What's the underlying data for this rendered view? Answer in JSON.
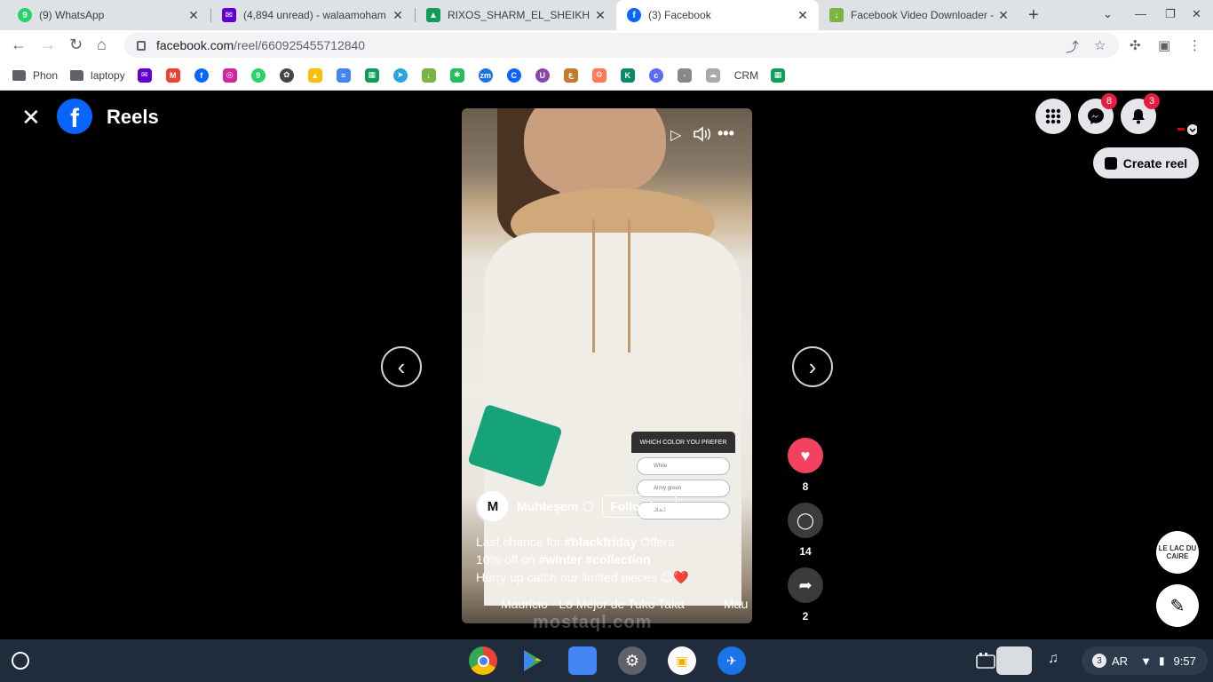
{
  "tabs": [
    {
      "title": "(9) WhatsApp",
      "color": "#25d366",
      "glyph": "9"
    },
    {
      "title": "(4,894 unread) - walaamoham",
      "color": "#6001d2",
      "glyph": "✉"
    },
    {
      "title": "RIXOS_SHARM_EL_SHEIKH - G",
      "color": "#0f9d58",
      "glyph": "▲"
    },
    {
      "title": "(3) Facebook",
      "color": "#0866ff",
      "glyph": "f"
    },
    {
      "title": "Facebook Video Downloader -",
      "color": "#7cb342",
      "glyph": "↓"
    }
  ],
  "omnibox": {
    "host": "facebook.com",
    "path": "/reel/660925455712840"
  },
  "bookmarks": {
    "folder1": "Phon",
    "folder2": "laptopy",
    "crm": "CRM"
  },
  "header": {
    "title": "Reels",
    "messenger_badge": "8",
    "notifications_badge": "3",
    "create_reel": "Create reel"
  },
  "reel": {
    "poll_title": "WHICH COLOR YOU PREFER",
    "poll_options": [
      "White",
      "Army green",
      "Black"
    ],
    "owner_name": "Muhteşem",
    "avatar_text": "M",
    "follow_label": "Following",
    "caption_line1_prefix": "Last chance for ",
    "caption_tag1": "#blackfriday",
    "caption_line1_suffix": " Offers",
    "caption_line2_prefix": "10% off on ",
    "caption_tag2": "#winter",
    "caption_tag3": "#collection",
    "caption_line3": "Hurry up catch our limited pieces 😉❤️",
    "audio": "Mauricio · Lo Mejor de Tuko Taka",
    "audio_overflow": "Mau"
  },
  "actions": {
    "likes": "8",
    "comments": "14",
    "shares": "2"
  },
  "side": {
    "lac_text": "LE LAC DU CAIRE"
  },
  "watermark": "mostaql.com",
  "shelf": {
    "notif_count": "3",
    "lang": "AR",
    "time": "9:57"
  }
}
